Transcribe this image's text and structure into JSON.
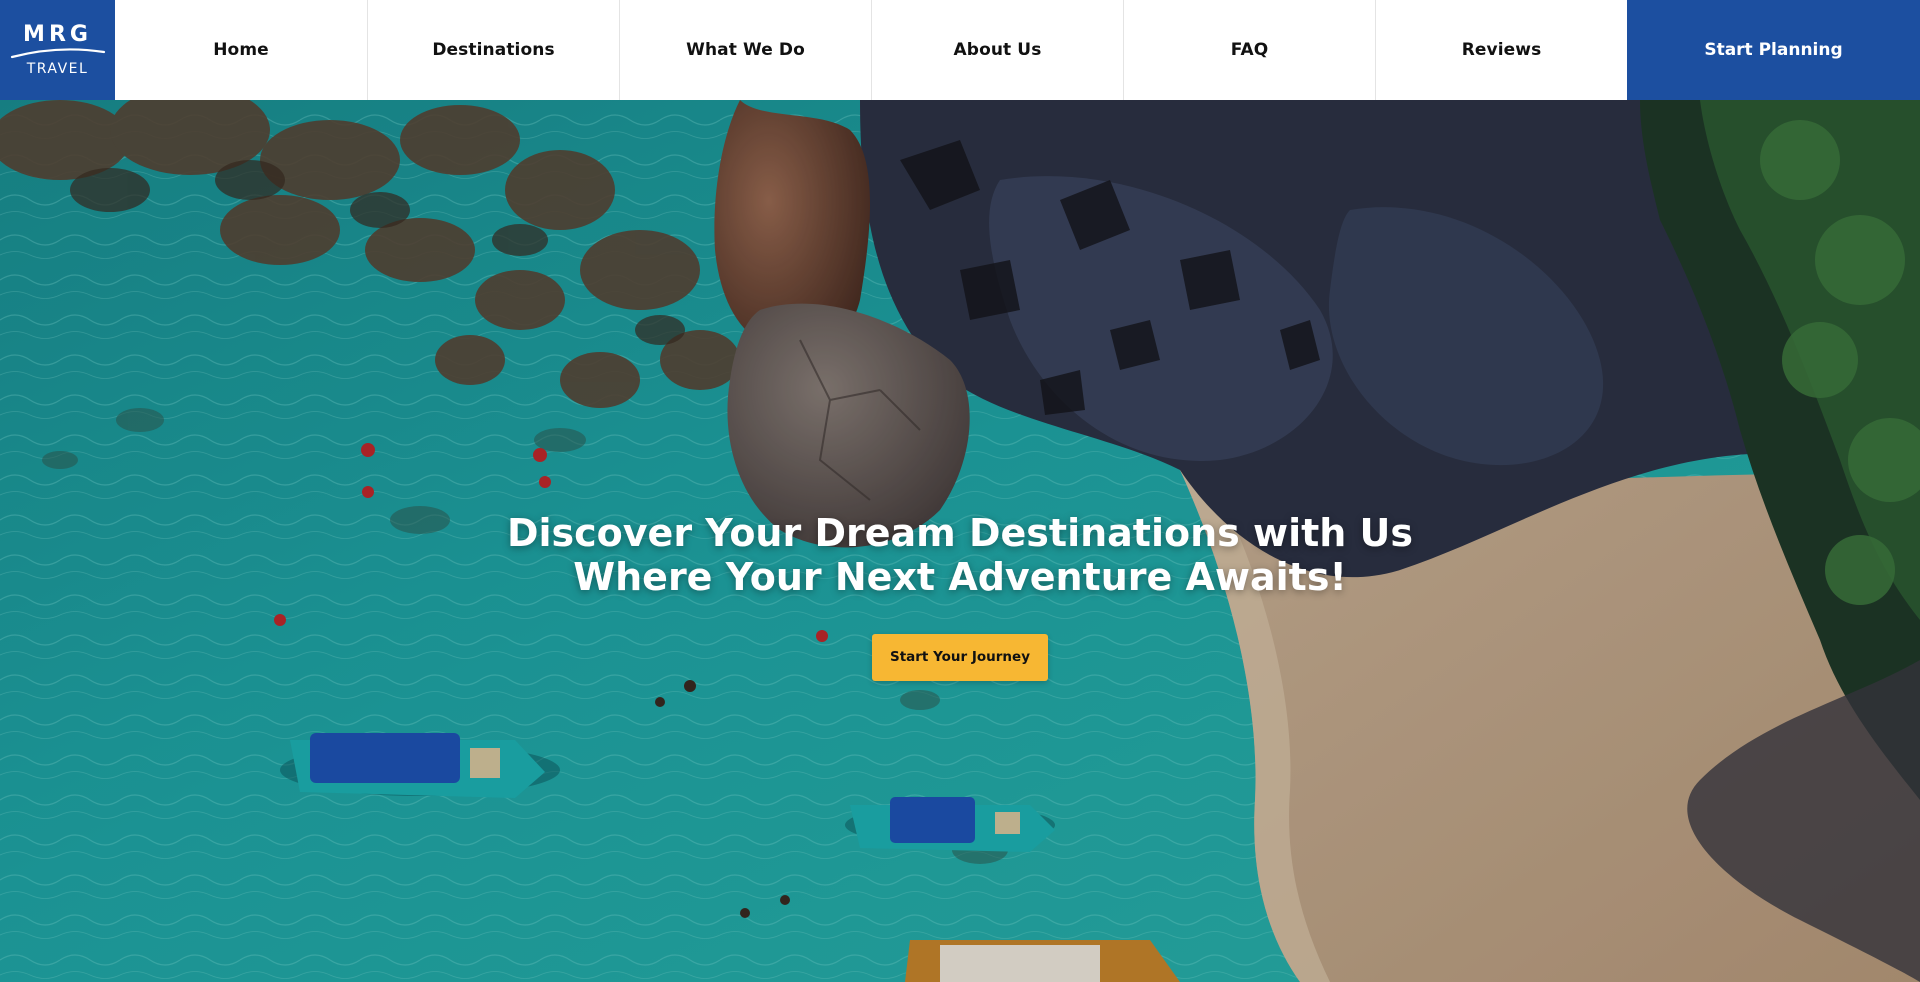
{
  "brand": {
    "mark": "MRG",
    "sub": "TRAVEL",
    "color": "#1c4fa0"
  },
  "nav": {
    "items": [
      {
        "label": "Home"
      },
      {
        "label": "Destinations"
      },
      {
        "label": "What We Do"
      },
      {
        "label": "About Us"
      },
      {
        "label": "FAQ"
      },
      {
        "label": "Reviews"
      }
    ],
    "cta_label": "Start Planning"
  },
  "hero": {
    "title_line1": "Discover Your Dream Destinations with Us",
    "title_line2": "Where Your Next Adventure Awaits!",
    "button_label": "Start Your Journey",
    "button_color": "#f7b733",
    "image_subject": "aerial view of turquoise lagoon, boats, swimmers, boulders and sandy beach"
  }
}
